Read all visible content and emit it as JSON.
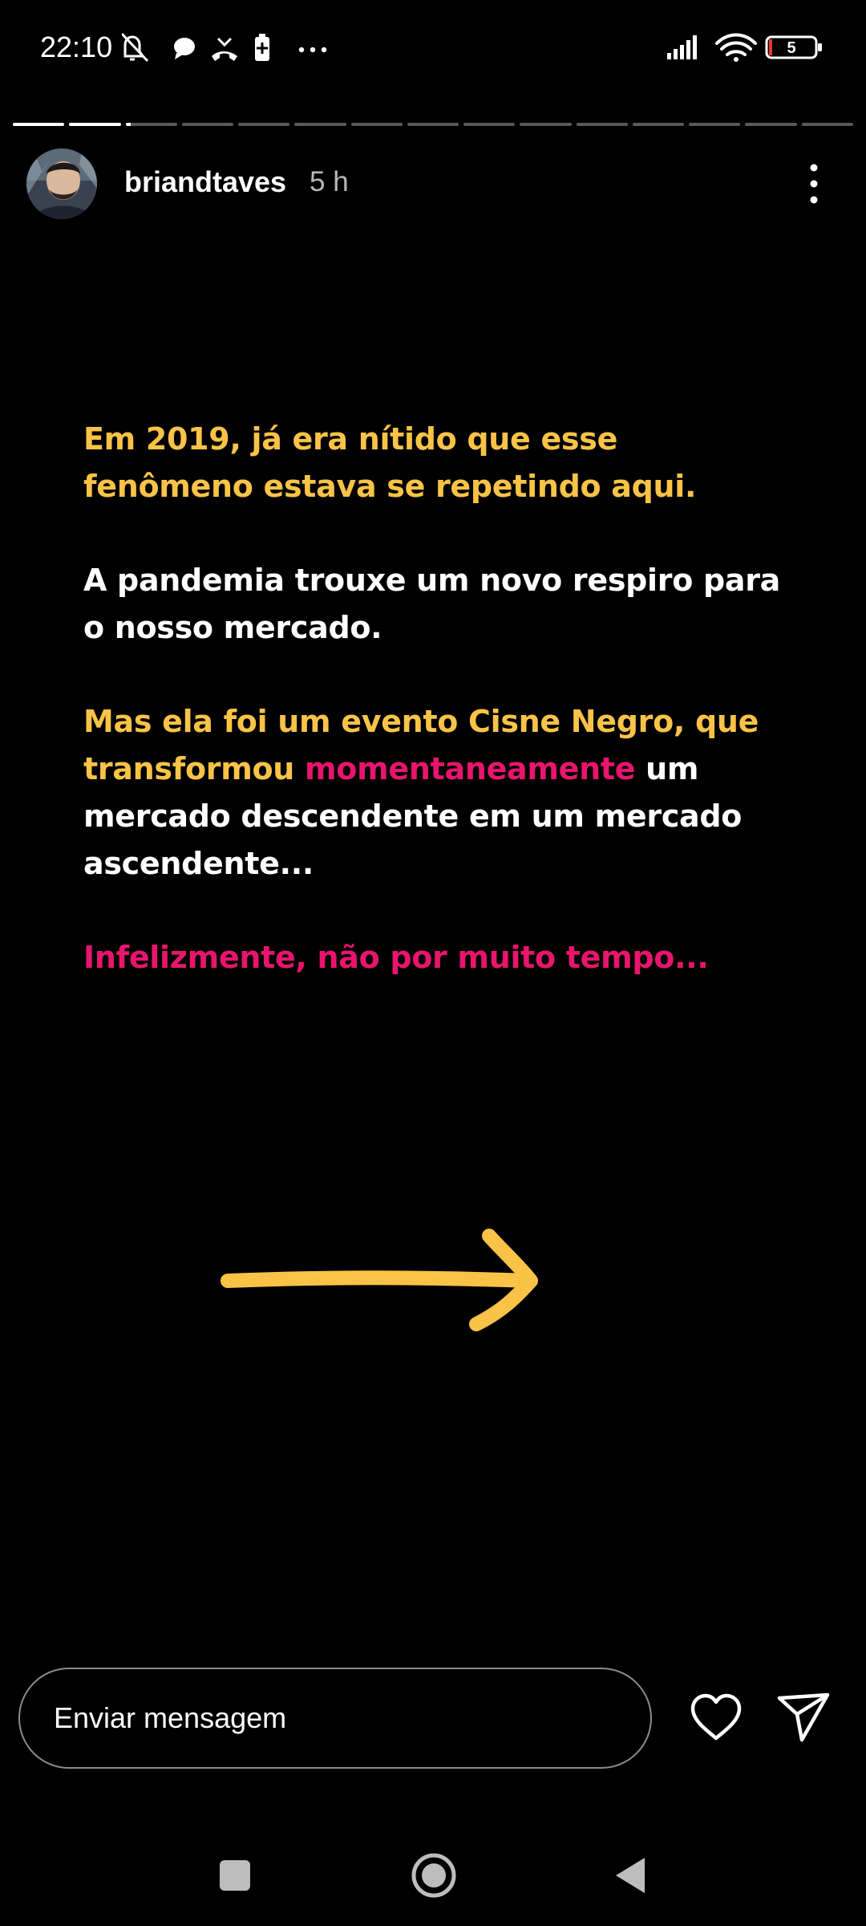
{
  "status_bar": {
    "time": "22:10",
    "battery_level": "5",
    "left_icons": [
      "mute-icon",
      "chat-bubble-icon",
      "missed-call-icon",
      "battery-saver-icon",
      "more-notifications-icon"
    ],
    "right_icons": [
      "signal-icon",
      "wifi-icon",
      "battery-icon"
    ]
  },
  "story": {
    "progress": {
      "segments": 15,
      "completed": 2,
      "current_fraction": 0.1
    },
    "username": "briandtaves",
    "time_ago": "5 h",
    "colors": {
      "yellow": "#f9c347",
      "white": "#ffffff",
      "pink": "#e8156e",
      "arrow": "#f9c347"
    },
    "text": {
      "p1_line1": "Em 2019, já era nítido que esse",
      "p1_line2": "fenômeno estava se repetindo aqui.",
      "p2_line1": "A pandemia trouxe um novo respiro para",
      "p2_line2": "o nosso mercado.",
      "p3_line1": "Mas ela foi um evento Cisne Negro, que",
      "p3_line2_a": "transformou ",
      "p3_line2_b": "momentaneamente",
      "p3_line2_c": " um",
      "p3_line3": "mercado descendente em um mercado",
      "p3_line4": "ascendente...",
      "p4_line1": "Infelizmente, não por muito tempo..."
    }
  },
  "message_bar": {
    "placeholder": "Enviar mensagem",
    "like_icon": "heart-icon",
    "send_icon": "send-icon"
  },
  "nav_bar": {
    "icons": [
      "recents-icon",
      "home-icon",
      "back-icon"
    ]
  }
}
